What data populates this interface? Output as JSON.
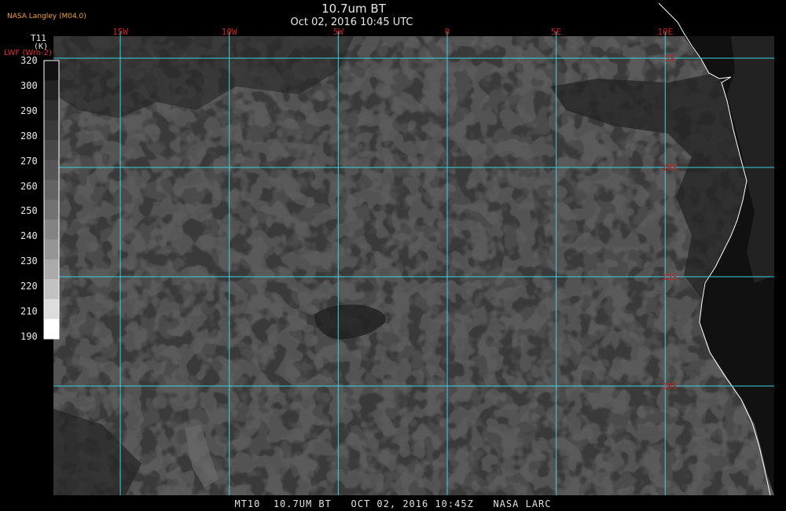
{
  "header": {
    "title": "10.7um BT",
    "subtitle": "Oct 02, 2016 10:45 UTC",
    "producer": "NASA Langley (M04.0)"
  },
  "colorbar": {
    "variable": "T11",
    "units": "(K)",
    "secondary_label": "LWF (Wm-2)",
    "ticks": [
      "320",
      "300",
      "290",
      "280",
      "270",
      "260",
      "250",
      "240",
      "230",
      "220",
      "210",
      "190"
    ],
    "steps": [
      "#111111",
      "#222222",
      "#2e2e2e",
      "#3a3a3a",
      "#474747",
      "#555555",
      "#636363",
      "#727272",
      "#838383",
      "#959595",
      "#aaaaaa",
      "#c2c2c2",
      "#dddddd",
      "#ffffff"
    ]
  },
  "map": {
    "lon_labels": [
      "15W",
      "10W",
      "5W",
      "0",
      "5E",
      "10E"
    ],
    "lon_values": [
      -15,
      -10,
      -5,
      0,
      5,
      10
    ],
    "lat_labels": [
      "5S",
      "10S",
      "15S",
      "20S"
    ],
    "lat_values": [
      -5,
      -10,
      -15,
      -20
    ],
    "grid_color": "#40d0e0",
    "label_color": "#cc2222",
    "coast_color": "#ffffff",
    "ocean_color": "#3a3a3a"
  },
  "footer": {
    "text": "MT10  10.7UM BT   OCT 02, 2016 10:45Z   NASA LARC"
  }
}
